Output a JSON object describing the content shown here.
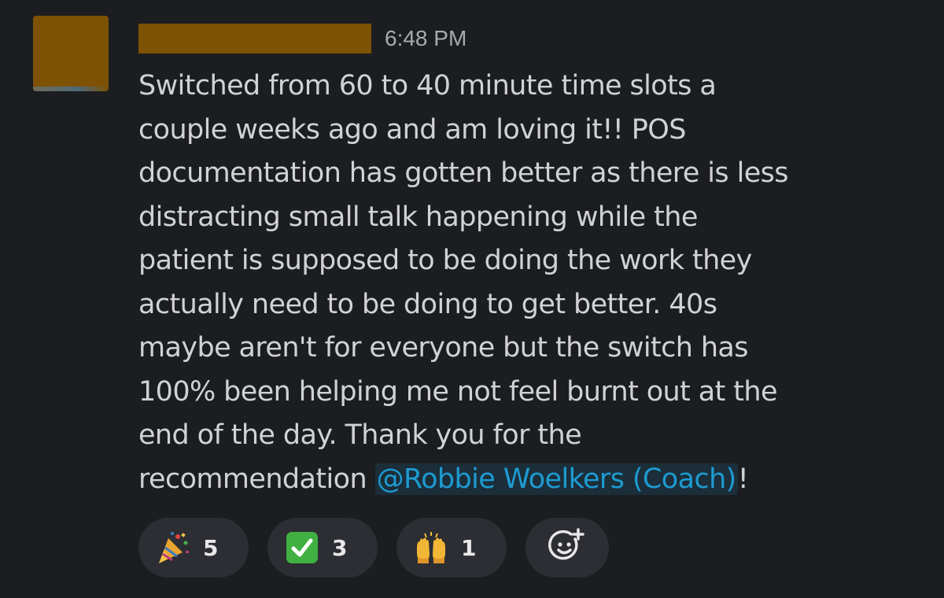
{
  "message": {
    "timestamp": "6:48 PM",
    "body_lines": [
      "Switched from 60 to 40 minute time slots a",
      "couple weeks ago and am loving it!! POS",
      "documentation has gotten better as there is less",
      "distracting small talk happening while the",
      "patient is supposed to be doing the work they",
      "actually need to be doing to get better. 40s",
      "maybe aren't for everyone but the switch has",
      "100% been helping me not feel burnt out at the",
      "end of the day. Thank you for the"
    ],
    "last_line_prefix": "recommendation ",
    "mention": "@Robbie Woelkers (Coach)",
    "last_line_suffix": "!"
  },
  "reactions": [
    {
      "icon": "party-popper-icon",
      "count": "5"
    },
    {
      "icon": "check-mark-icon",
      "count": "3"
    },
    {
      "icon": "raising-hands-icon",
      "count": "1"
    }
  ],
  "add_reaction_icon": "add-emoji-icon",
  "colors": {
    "background": "#1b1d21",
    "text": "#d1d2d3",
    "timestamp": "#a9aaad",
    "mention": "#1d9bd1",
    "reaction_pill": "#2c2e33",
    "redaction": "#7d5205",
    "check_green": "#3fb041"
  }
}
